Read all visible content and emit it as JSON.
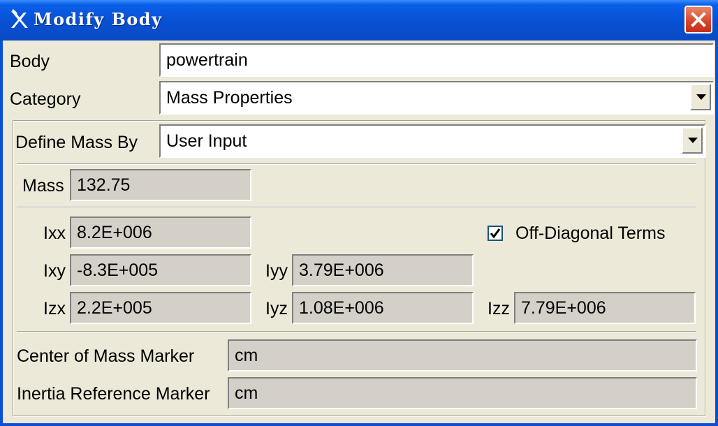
{
  "window": {
    "title": "Modify Body"
  },
  "form": {
    "body_label": "Body",
    "body_value": "powertrain",
    "category_label": "Category",
    "category_value": "Mass Properties",
    "define_mass_label": "Define Mass By",
    "define_mass_value": "User Input",
    "mass_label": "Mass",
    "mass_value": "132.75",
    "ixx_label": "Ixx",
    "ixx_value": "8.2E+006",
    "ixy_label": "Ixy",
    "ixy_value": "-8.3E+005",
    "izx_label": "Izx",
    "izx_value": "2.2E+005",
    "iyy_label": "Iyy",
    "iyy_value": "3.79E+006",
    "iyz_label": "Iyz",
    "iyz_value": "1.08E+006",
    "izz_label": "Izz",
    "izz_value": "7.79E+006",
    "off_diag_label": "Off-Diagonal Terms",
    "off_diag_checked": true,
    "cm_marker_label": "Center of Mass Marker",
    "cm_marker_value": "cm",
    "inertia_ref_label": "Inertia Reference Marker",
    "inertia_ref_value": "cm"
  },
  "colors": {
    "titlebar": "#0850d2",
    "close_button": "#d8442a",
    "dialog_bg": "#ece9d8",
    "readonly_field": "#d4d0c8"
  },
  "icons": {
    "app": "adams-logo-icon",
    "close": "close-x-icon",
    "dropdown": "triangle-down-icon",
    "check": "checkmark-icon"
  }
}
